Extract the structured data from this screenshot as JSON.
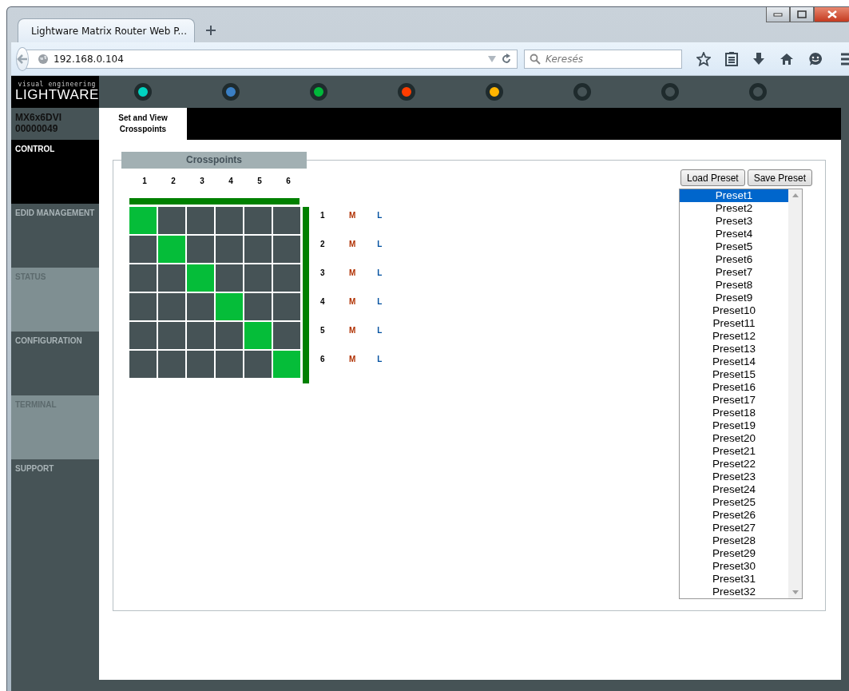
{
  "browser": {
    "tab_title": "Lightware Matrix Router Web P...",
    "address": "192.168.0.104",
    "search": {
      "placeholder": "Keresés"
    }
  },
  "logo": {
    "tagline": "visual engineering",
    "name": "LIGHTWARE"
  },
  "indicators": [
    {
      "lit": true,
      "color": "#00d4c0"
    },
    {
      "lit": true,
      "color": "#3a7fc4"
    },
    {
      "lit": true,
      "color": "#00b83a"
    },
    {
      "lit": true,
      "color": "#ff3d00"
    },
    {
      "lit": true,
      "color": "#ffb400"
    },
    {
      "lit": false
    },
    {
      "lit": false
    },
    {
      "lit": false
    }
  ],
  "device": {
    "model": "MX6x6DVI",
    "serial": "00000049"
  },
  "sidebar": {
    "items": [
      {
        "label": "CONTROL",
        "selected": true
      },
      {
        "label": "EDID MANAGEMENT",
        "selected": false
      },
      {
        "label": "STATUS",
        "selected": false
      },
      {
        "label": "CONFIGURATION",
        "selected": false
      },
      {
        "label": "TERMINAL",
        "selected": false
      },
      {
        "label": "SUPPORT",
        "selected": false
      }
    ]
  },
  "tabs": [
    {
      "label": "Set and View Crosspoints",
      "selected": true
    }
  ],
  "crosspoints": {
    "title": "Crosspoints",
    "inputs": [
      "1",
      "2",
      "3",
      "4",
      "5",
      "6"
    ],
    "outputs": [
      {
        "label": "1",
        "mute": "M",
        "lock": "L",
        "cells": [
          {
            "on": true
          },
          {
            "on": false
          },
          {
            "on": false
          },
          {
            "on": false
          },
          {
            "on": false
          },
          {
            "on": false
          }
        ]
      },
      {
        "label": "2",
        "mute": "M",
        "lock": "L",
        "cells": [
          {
            "on": false
          },
          {
            "on": true
          },
          {
            "on": false
          },
          {
            "on": false
          },
          {
            "on": false
          },
          {
            "on": false
          }
        ]
      },
      {
        "label": "3",
        "mute": "M",
        "lock": "L",
        "cells": [
          {
            "on": false
          },
          {
            "on": false
          },
          {
            "on": true
          },
          {
            "on": false
          },
          {
            "on": false
          },
          {
            "on": false
          }
        ]
      },
      {
        "label": "4",
        "mute": "M",
        "lock": "L",
        "cells": [
          {
            "on": false
          },
          {
            "on": false
          },
          {
            "on": false
          },
          {
            "on": true
          },
          {
            "on": false
          },
          {
            "on": false
          }
        ]
      },
      {
        "label": "5",
        "mute": "M",
        "lock": "L",
        "cells": [
          {
            "on": false
          },
          {
            "on": false
          },
          {
            "on": false
          },
          {
            "on": false
          },
          {
            "on": true
          },
          {
            "on": false
          }
        ]
      },
      {
        "label": "6",
        "mute": "M",
        "lock": "L",
        "cells": [
          {
            "on": false
          },
          {
            "on": false
          },
          {
            "on": false
          },
          {
            "on": false
          },
          {
            "on": false
          },
          {
            "on": true
          }
        ]
      }
    ]
  },
  "presets": {
    "buttons": [
      "Load Preset",
      "Save Preset"
    ],
    "items": [
      {
        "label": "Preset1",
        "selected": true
      },
      {
        "label": "Preset2",
        "selected": false
      },
      {
        "label": "Preset3",
        "selected": false
      },
      {
        "label": "Preset4",
        "selected": false
      },
      {
        "label": "Preset5",
        "selected": false
      },
      {
        "label": "Preset6",
        "selected": false
      },
      {
        "label": "Preset7",
        "selected": false
      },
      {
        "label": "Preset8",
        "selected": false
      },
      {
        "label": "Preset9",
        "selected": false
      },
      {
        "label": "Preset10",
        "selected": false
      },
      {
        "label": "Preset11",
        "selected": false
      },
      {
        "label": "Preset12",
        "selected": false
      },
      {
        "label": "Preset13",
        "selected": false
      },
      {
        "label": "Preset14",
        "selected": false
      },
      {
        "label": "Preset15",
        "selected": false
      },
      {
        "label": "Preset16",
        "selected": false
      },
      {
        "label": "Preset17",
        "selected": false
      },
      {
        "label": "Preset18",
        "selected": false
      },
      {
        "label": "Preset19",
        "selected": false
      },
      {
        "label": "Preset20",
        "selected": false
      },
      {
        "label": "Preset21",
        "selected": false
      },
      {
        "label": "Preset22",
        "selected": false
      },
      {
        "label": "Preset23",
        "selected": false
      },
      {
        "label": "Preset24",
        "selected": false
      },
      {
        "label": "Preset25",
        "selected": false
      },
      {
        "label": "Preset26",
        "selected": false
      },
      {
        "label": "Preset27",
        "selected": false
      },
      {
        "label": "Preset28",
        "selected": false
      },
      {
        "label": "Preset29",
        "selected": false
      },
      {
        "label": "Preset30",
        "selected": false
      },
      {
        "label": "Preset31",
        "selected": false
      },
      {
        "label": "Preset32",
        "selected": false
      }
    ]
  }
}
